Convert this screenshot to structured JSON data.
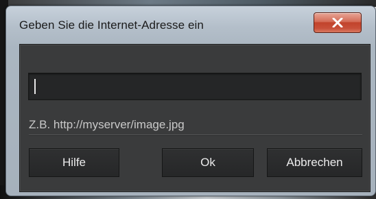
{
  "dialog": {
    "title": "Geben Sie die Internet-Adresse ein",
    "close_icon": "close-icon",
    "url_input": {
      "value": "",
      "placeholder": ""
    },
    "example_text": "Z.B. http://myserver/image.jpg",
    "buttons": {
      "help": "Hilfe",
      "ok": "Ok",
      "cancel": "Abbrechen"
    }
  },
  "colors": {
    "client_background": "#3a3b3c",
    "input_background": "#252627",
    "close_button": "#c8503a"
  }
}
